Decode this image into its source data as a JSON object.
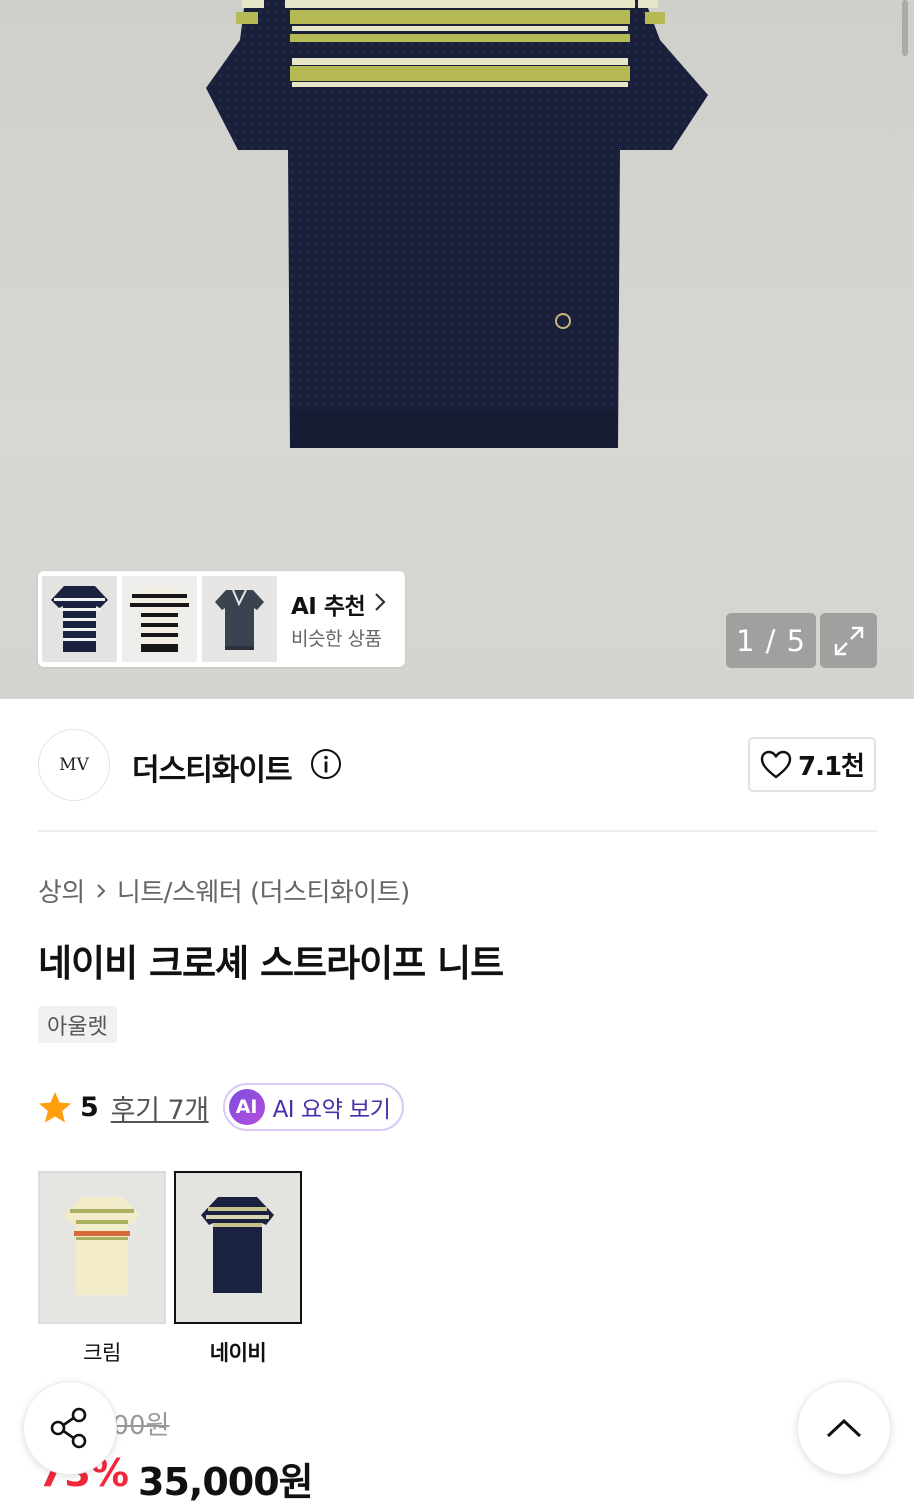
{
  "gallery": {
    "counter": "1 / 5",
    "ai_recommend": {
      "title": "AI 추천",
      "subtitle": "비슷한 상품"
    }
  },
  "brand": {
    "logo_text": "MV",
    "name": "더스티화이트",
    "likes": "7.1천"
  },
  "breadcrumb": {
    "category": "상의",
    "subcategory": "니트/스웨터 (더스티화이트)"
  },
  "product": {
    "title": "네이비 크로셰 스트라이프 니트",
    "tag": "아울렛",
    "rating": "5",
    "reviews": "후기 7개",
    "ai_summary_badge": "AI",
    "ai_summary_label": "AI 요약 보기"
  },
  "colors": [
    {
      "label": "크림"
    },
    {
      "label": "네이비"
    }
  ],
  "price": {
    "original": "130,000원",
    "discount": "73%",
    "sale": "35,000원"
  },
  "accent": {
    "discount_red": "#f0283c",
    "star": "#ff9e0d",
    "ai_purple": "#7b4ce0"
  },
  "icons": [
    "info-icon",
    "heart-icon",
    "chevron-right-icon",
    "expand-icon",
    "star-icon",
    "share-icon",
    "chevron-up-icon"
  ]
}
